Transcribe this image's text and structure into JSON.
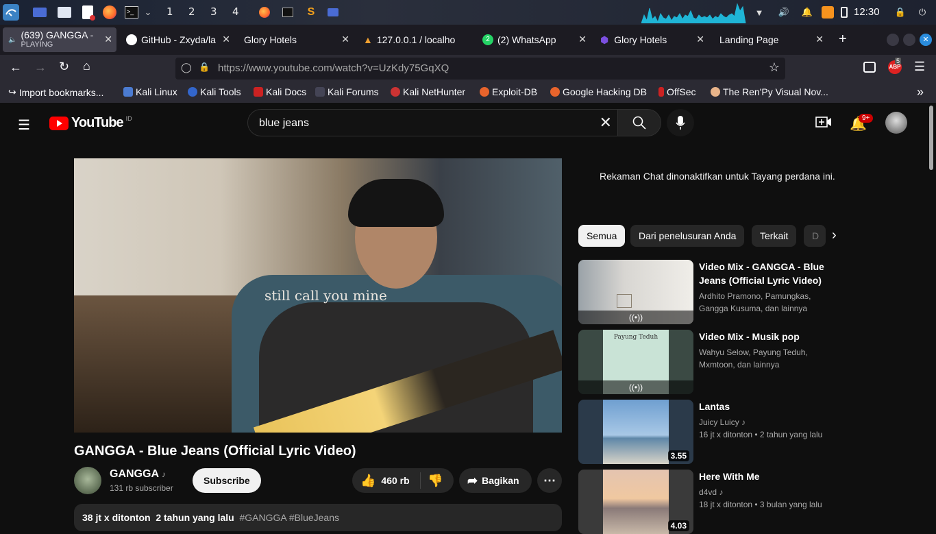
{
  "taskbar": {
    "workspaces": [
      "1",
      "2",
      "3",
      "4"
    ],
    "clock": "12:30"
  },
  "tabs": [
    {
      "label": "(639) GANGGA -",
      "sub": "PLAYING"
    },
    {
      "label": "GitHub - Zxyda/la"
    },
    {
      "label": "Glory Hotels"
    },
    {
      "label": "127.0.0.1 / localho"
    },
    {
      "label": "(2) WhatsApp"
    },
    {
      "label": "Glory Hotels"
    },
    {
      "label": "Landing Page"
    }
  ],
  "navbar": {
    "url": "https://www.youtube.com/watch?v=UzKdy75GqXQ",
    "abp_count": "5"
  },
  "bookmarks": [
    "Import bookmarks...",
    "Kali Linux",
    "Kali Tools",
    "Kali Docs",
    "Kali Forums",
    "Kali NetHunter",
    "Exploit-DB",
    "Google Hacking DB",
    "OffSec",
    "The Ren'Py Visual Nov..."
  ],
  "youtube": {
    "logo": "YouTube",
    "region": "ID",
    "search_value": "blue jeans",
    "notifications": "9+",
    "video_overlay_text": "still call you mine",
    "video_title": "GANGGA - Blue Jeans (Official Lyric Video)",
    "channel_name": "GANGGA",
    "subscribers": "131 rb subscriber",
    "subscribe_label": "Subscribe",
    "likes": "460 rb",
    "share_label": "Bagikan",
    "desc_views": "38 jt x ditonton",
    "desc_date": "2 tahun yang lalu",
    "desc_tags": "#GANGGA #BlueJeans",
    "chat_disabled": "Rekaman Chat dinonaktifkan untuk Tayang perdana ini.",
    "chips": [
      "Semua",
      "Dari penelusuran Anda",
      "Terkait",
      "D"
    ],
    "recommendations": [
      {
        "title": "Video Mix - GANGGA - Blue Jeans (Official Lyric Video)",
        "meta1": "Ardhito Pramono, Pamungkas,",
        "meta2": "Gangga Kusuma, dan lainnya"
      },
      {
        "title": "Video Mix - Musik pop",
        "meta1": "Wahyu Selow, Payung Teduh,",
        "meta2": "Mxmtoon, dan lainnya",
        "thumb_text": "Payung Teduh"
      },
      {
        "title": "Lantas",
        "meta1": "Juicy Luicy",
        "meta2": "16 jt x ditonton  • 2 tahun yang lalu",
        "duration": "3.55"
      },
      {
        "title": "Here With Me",
        "meta1": "d4vd",
        "meta2": "18 jt x ditonton  • 3 bulan yang lalu",
        "duration": "4.03"
      }
    ]
  }
}
